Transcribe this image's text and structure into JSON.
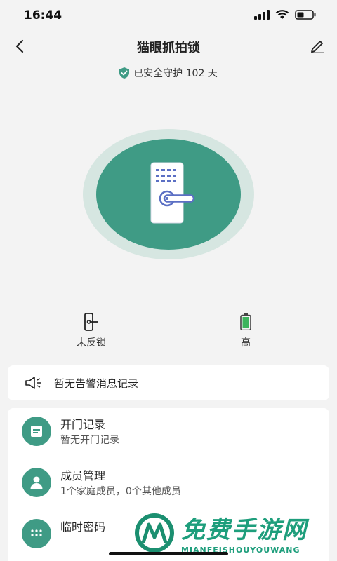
{
  "status_bar": {
    "time": "16:44"
  },
  "header": {
    "title": "猫眼抓拍锁"
  },
  "guard_banner": {
    "text": "已安全守护 102 天"
  },
  "status_row": [
    {
      "label": "未反锁",
      "icon": "door-lock-icon"
    },
    {
      "label": "高",
      "icon": "battery-icon"
    }
  ],
  "alert": {
    "text": "暂无告警消息记录",
    "icon": "speaker-icon"
  },
  "menu": [
    {
      "title": "开门记录",
      "subtitle": "暂无开门记录",
      "icon": "record-icon"
    },
    {
      "title": "成员管理",
      "subtitle": "1个家庭成员，0个其他成员",
      "icon": "person-icon"
    },
    {
      "title": "临时密码",
      "subtitle": "",
      "icon": "keypad-icon"
    }
  ],
  "watermark": {
    "title": "免费手游网",
    "subtitle": "MIANFEISHOUYOUWANG"
  },
  "colors": {
    "accent": "#3f9b85",
    "accent_light": "#d6e6e1",
    "background": "#f3f3f3"
  }
}
